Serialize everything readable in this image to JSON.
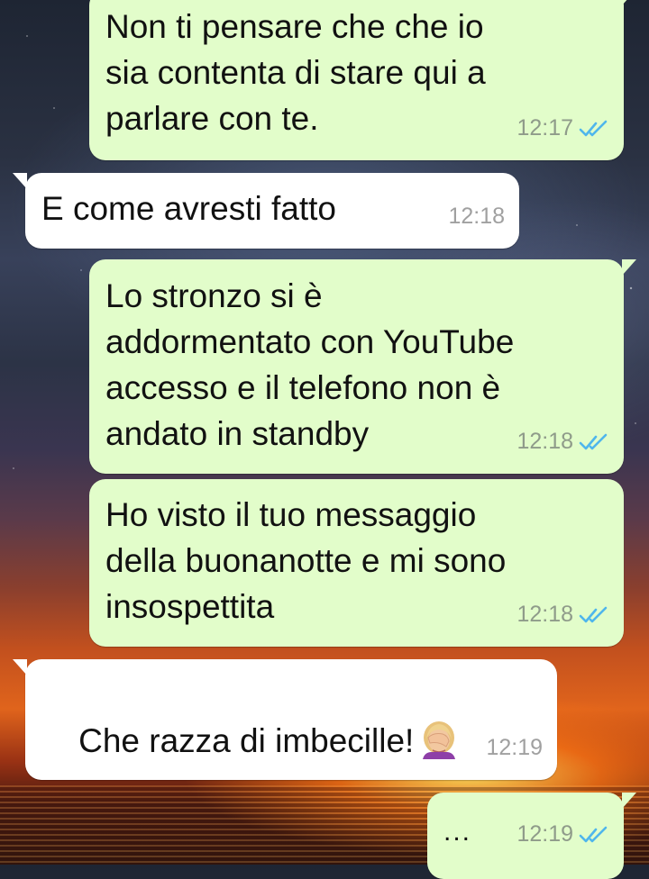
{
  "chat": {
    "messages": [
      {
        "direction": "outgoing",
        "text": "Non ti pensare che che io\nsia contenta di stare qui a\nparlare con te.",
        "time": "12:17",
        "status": "read"
      },
      {
        "direction": "incoming",
        "text": "E come avresti fatto",
        "time": "12:18"
      },
      {
        "direction": "outgoing",
        "text": "Lo stronzo si è\naddormentato con YouTube\naccesso e il telefono non è\nandato in standby",
        "time": "12:18",
        "status": "read"
      },
      {
        "direction": "outgoing",
        "text": "Ho visto il tuo messaggio\ndella buonanotte e mi sono\ninsospettita",
        "time": "12:18",
        "status": "read"
      },
      {
        "direction": "incoming",
        "text": "Che razza di imbecille!",
        "emoji": "woman-facepalming-emoji",
        "time": "12:19"
      },
      {
        "direction": "outgoing",
        "text": "...",
        "time": "12:19",
        "status": "read"
      }
    ]
  },
  "colors": {
    "outgoing_bubble": "#e2fdca",
    "incoming_bubble": "#ffffff",
    "read_ticks": "#4fb6ec",
    "timestamp": "#8f9b8a"
  },
  "icons": {
    "read_receipt": "double-check-icon"
  }
}
